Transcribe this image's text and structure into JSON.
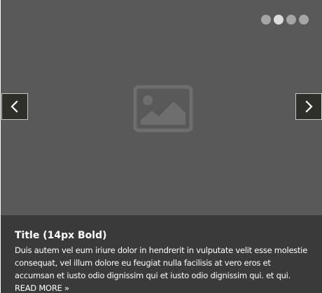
{
  "slider": {
    "dots_count": 4,
    "active_dot": 1,
    "caption": {
      "title": "Title (14px Bold)",
      "text": "Duis autem vel eum iriure dolor in hendrerit in vulputate velit esse molestie consequat, vel illum dolore eu feugiat nulla facilisis at vero eros et accumsan et iusto odio dignissim qui et iusto odio dignissim qui. et qui.",
      "read_more": "READ MORE »"
    }
  },
  "icons": {
    "prev": "chevron-left-icon",
    "next": "chevron-right-icon",
    "placeholder": "image-placeholder-icon"
  },
  "colors": {
    "slide_bg": "#595959",
    "caption_bg": "#3a3a3a",
    "arrow_bg": "#2f2f2a",
    "dot_inactive": "#a6a6a6",
    "dot_active": "#dddddd"
  }
}
